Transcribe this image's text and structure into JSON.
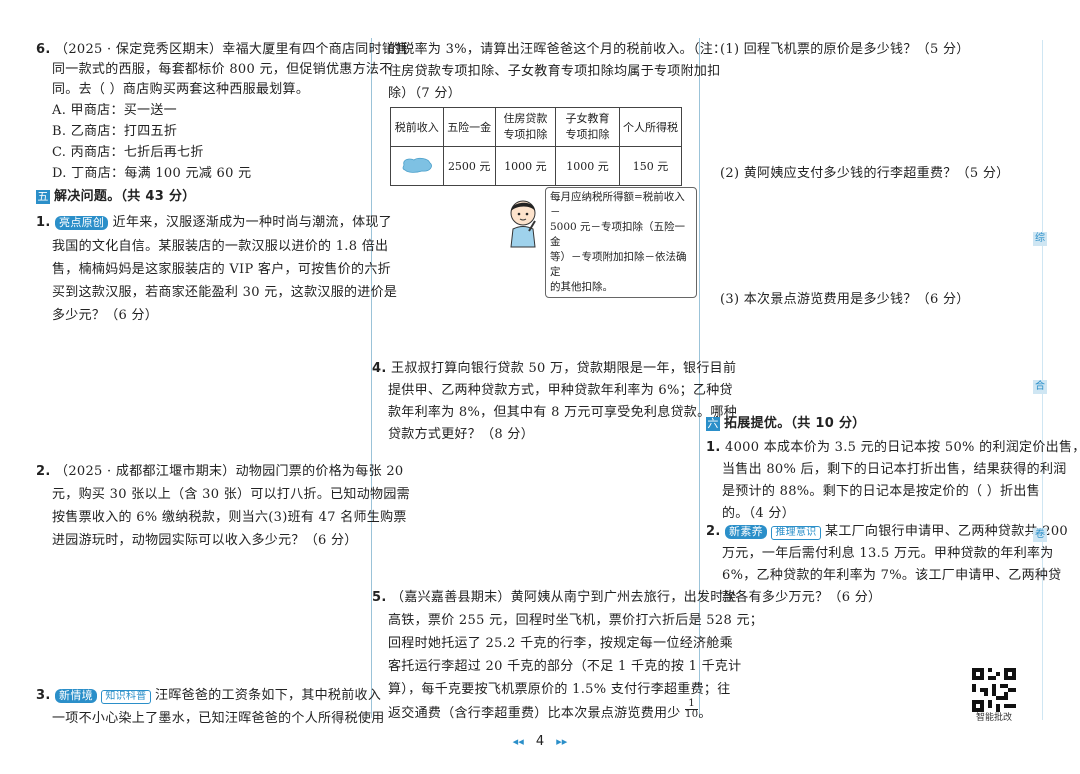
{
  "left": {
    "q6": {
      "num": "6.",
      "lines": [
        "（2025 · 保定竞秀区期末）幸福大厦里有四个商店同时销售",
        "同一款式的西服，每套都标价 800 元，但促销优惠方法不",
        "同。去（     ）商店购买两套这种西服最划算。"
      ],
      "options": [
        "A. 甲商店：买一送一",
        "B. 乙商店：打四五折",
        "C. 丙商店：七折后再七折",
        "D. 丁商店：每满 100 元减 60 元"
      ]
    },
    "section5": {
      "num": "五",
      "title": "解决问题。（共 43 分）"
    },
    "q1": {
      "num": "1.",
      "badge": "亮点原创",
      "lines": [
        "近年来，汉服逐渐成为一种时尚与潮流，体现了",
        "我国的文化自信。某服装店的一款汉服以进价的 1.8 倍出",
        "售，楠楠妈妈是这家服装店的 VIP 客户，可按售价的六折",
        "买到这款汉服，若商家还能盈利 30 元，这款汉服的进价是",
        "多少元？（6 分）"
      ]
    },
    "q2": {
      "num": "2.",
      "lines": [
        "（2025 · 成都都江堰市期末）动物园门票的价格为每张 20",
        "元，购买 30 张以上（含 30 张）可以打八折。已知动物园需",
        "按售票收入的 6% 缴纳税款，则当六(3)班有 47 名师生购票",
        "进园游玩时，动物园实际可以收入多少元？（6 分）"
      ]
    },
    "q3": {
      "num": "3.",
      "badge": "新情境",
      "badge2": "知识科普",
      "lines": [
        "汪晖爸爸的工资条如下，其中税前收入",
        "一项不小心染上了墨水，已知汪晖爸爸的个人所得税使用"
      ]
    }
  },
  "middle": {
    "q3cont": [
      "的税率为 3%，请算出汪晖爸爸这个月的税前收入。（注：",
      "住房贷款专项扣除、子女教育专项扣除均属于专项附加扣",
      "除）（7 分）"
    ],
    "table": {
      "headers": [
        "税前收入",
        "五险一金",
        "住房贷款\n专项扣除",
        "子女教育\n专项扣除",
        "个人所得税"
      ],
      "row": [
        "",
        "2500 元",
        "1000 元",
        "1000 元",
        "150 元"
      ]
    },
    "bubble": [
      "每月应纳税所得额=税前收入－",
      "5000 元－专项扣除（五险一金",
      "等）－专项附加扣除－依法确定",
      "的其他扣除。"
    ],
    "q4": {
      "num": "4.",
      "lines": [
        "王叔叔打算向银行贷款 50 万，贷款期限是一年，银行目前",
        "提供甲、乙两种贷款方式，甲种贷款年利率为 6%；乙种贷",
        "款年利率为 8%，但其中有 8 万元可享受免利息贷款。哪种",
        "贷款方式更好？（8 分）"
      ]
    },
    "q5": {
      "num": "5.",
      "lines": [
        "（嘉兴嘉善县期末）黄阿姨从南宁到广州去旅行，出发时坐",
        "高铁，票价 255 元，回程时坐飞机，票价打六折后是 528 元；",
        "回程时她托运了 25.2 千克的行李，按规定每一位经济舱乘",
        "客托运行李超过 20 千克的部分（不足 1 千克的按 1 千克计",
        "算），每千克要按飞机票原价的 1.5% 支付行李超重费；往",
        "返交通费（含行李超重费）比本次景点游览费用少"
      ],
      "frac_num": "1",
      "frac_den": "10",
      "frac_end": "。"
    }
  },
  "right": {
    "p1": "(1) 回程飞机票的原价是多少钱？（5 分）",
    "p2": "(2) 黄阿姨应支付多少钱的行李超重费？（5 分）",
    "p3": "(3) 本次景点游览费用是多少钱？（6 分）",
    "section6": {
      "num": "六",
      "title": "拓展提优。（共 10 分）"
    },
    "q1": {
      "num": "1.",
      "lines": [
        "4000 本成本价为 3.5 元的日记本按 50% 的利润定价出售，",
        "当售出 80% 后，剩下的日记本打折出售，结果获得的利润",
        "是预计的 88%。剩下的日记本是按定价的（     ）折出售",
        "的。（4 分）"
      ]
    },
    "q2": {
      "num": "2.",
      "badge": "新素养",
      "badge2": "推理意识",
      "lines": [
        "某工厂向银行申请甲、乙两种贷款共 200",
        "万元，一年后需付利息 13.5 万元。甲种贷款的年利率为",
        "6%，乙种贷款的年利率为 7%。该工厂申请甲、乙两种贷",
        "款各有多少万元？（6 分）"
      ]
    },
    "qr_label": "智能批改",
    "side_tabs": [
      "综",
      "合",
      "卷"
    ]
  },
  "footer": {
    "page": "4",
    "prev": "◂◂",
    "next": "▸▸"
  },
  "colors": {
    "accent": "#2b8fc9",
    "ink_blot": "#7ec1e3"
  }
}
